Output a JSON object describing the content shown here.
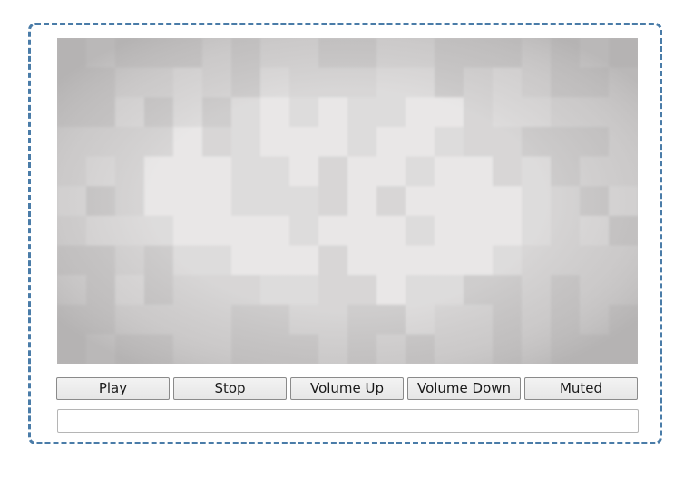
{
  "player": {
    "video": {
      "content": "blurred-gray-pixel-pattern",
      "base_color": "#cfcdcd",
      "light_color": "#e4e2e2",
      "mid_color": "#d6d4d4",
      "dark_color": "#c4c2c2"
    },
    "controls": {
      "play_label": "Play",
      "stop_label": "Stop",
      "volume_up_label": "Volume Up",
      "volume_down_label": "Volume Down",
      "muted_label": "Muted"
    },
    "status": {
      "value": "",
      "placeholder": ""
    },
    "frame_border_color": "#4a7ca8"
  }
}
